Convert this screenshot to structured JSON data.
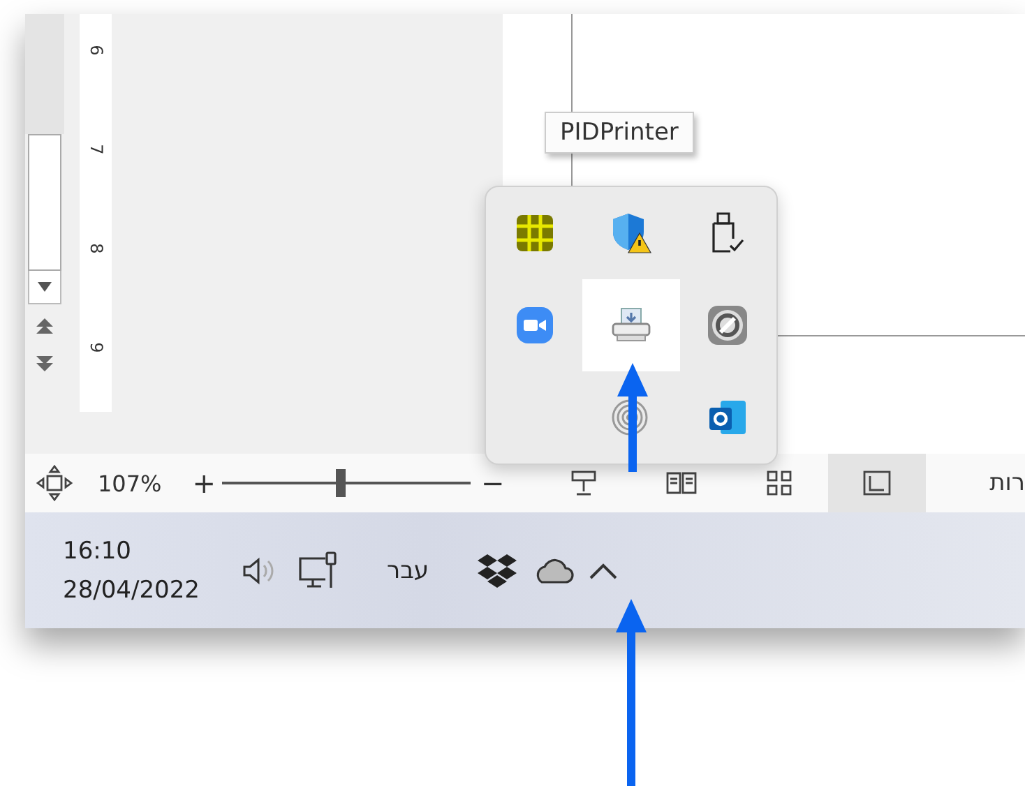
{
  "ruler": {
    "labels": [
      "6",
      "7",
      "8",
      "9"
    ]
  },
  "tooltip": {
    "text": "PIDPrinter"
  },
  "tray_popup": {
    "rows": [
      [
        {
          "kind": "chip",
          "selected": false
        },
        {
          "kind": "shield",
          "selected": false
        },
        {
          "kind": "usb",
          "selected": false
        }
      ],
      [
        {
          "kind": "video",
          "selected": false
        },
        {
          "kind": "printer",
          "selected": true
        },
        {
          "kind": "disc",
          "selected": false
        }
      ],
      [
        {
          "kind": "rings",
          "selected": false
        },
        {
          "kind": "mail",
          "selected": false
        }
      ]
    ]
  },
  "status_bar": {
    "zoom": "107%",
    "plus": "+",
    "minus": "−",
    "zoom_slider": {
      "level": 0.48
    },
    "views": [
      {
        "kind": "presenter",
        "selected": false
      },
      {
        "kind": "book",
        "selected": false
      },
      {
        "kind": "grid",
        "selected": false
      },
      {
        "kind": "page",
        "selected": true
      }
    ],
    "language_text": "רות"
  },
  "taskbar": {
    "time": "16:10",
    "date": "28/04/2022",
    "input_language": "עבר"
  }
}
